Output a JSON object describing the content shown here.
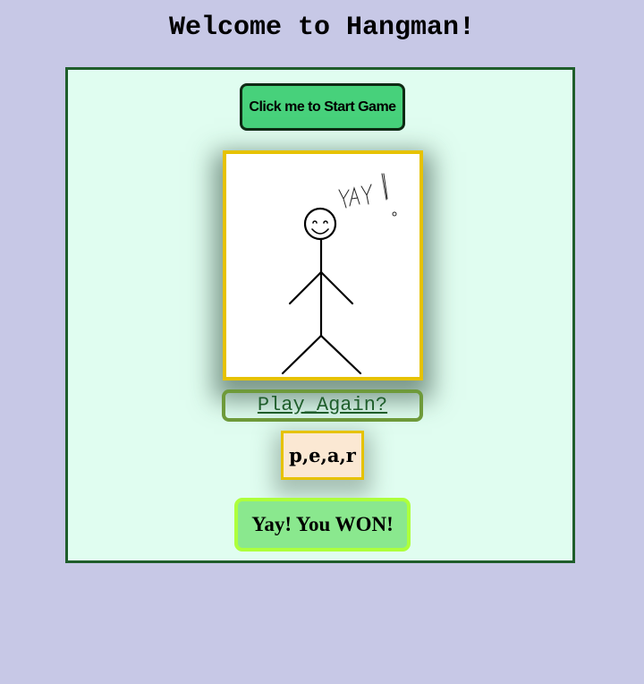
{
  "page": {
    "title": "Welcome to Hangman!"
  },
  "game": {
    "start_button_label": "Click me to Start Game",
    "drawing": {
      "caption": "YAY!",
      "figure": "happy stick figure"
    },
    "play_again_label": "Play_Again?",
    "word": "p,e,a,r",
    "result_message": "Yay! You WON!"
  },
  "colors": {
    "background": "#c7c8e6",
    "game_box_bg": "#e0fdf0",
    "game_box_border": "#1f5e2b",
    "start_button_bg": "#47d17b",
    "frame_border": "#e6c200",
    "play_again_border": "#6e9a3a",
    "word_box_bg": "#fbe8d3",
    "result_bg": "#8ae88e",
    "result_border": "#adff3c"
  }
}
